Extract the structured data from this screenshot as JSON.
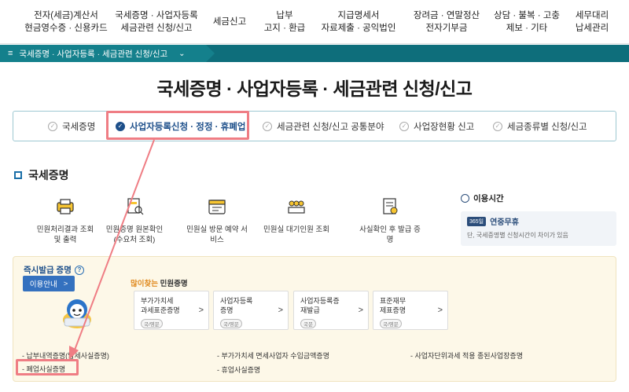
{
  "topnav": [
    {
      "line1": "전자(세금)계산서",
      "line2": "현금영수증 · 신용카드"
    },
    {
      "line1": "국세증명 · 사업자등록",
      "line2": "세금관련 신청/신고"
    },
    {
      "line1": "세금신고",
      "line2": ""
    },
    {
      "line1": "납부",
      "line2": "고지 · 환급"
    },
    {
      "line1": "지급명세서",
      "line2": "자료제출 · 공익법인"
    },
    {
      "line1": "장려금 · 연말정산",
      "line2": "전자기부금"
    },
    {
      "line1": "상담 · 불복 · 고충",
      "line2": "제보 · 기타"
    },
    {
      "line1": "세무대리",
      "line2": "납세관리"
    }
  ],
  "breadcrumb": {
    "menu_icon": "≡",
    "label": "국세증명 · 사업자등록 · 세금관련 신청/신고",
    "chevron": "⌄"
  },
  "page_title": "국세증명 · 사업자등록 · 세금관련 신청/신고",
  "tabs": [
    {
      "label": "국세증명",
      "active": false
    },
    {
      "label": "사업자등록신청 · 정정 · 휴폐업",
      "active": true
    },
    {
      "label": "세금관련 신청/신고 공통분야",
      "active": false
    },
    {
      "label": "사업장현황 신고",
      "active": false
    },
    {
      "label": "세금종류별 신청/신고",
      "active": false
    }
  ],
  "section_title": "국세증명",
  "services": [
    {
      "line1": "민원처리결과 조회",
      "line2": "및 출력",
      "icon": "printer-icon"
    },
    {
      "line1": "민원증명 원본확인",
      "line2": "(수요처 조회)",
      "icon": "document-search-icon"
    },
    {
      "line1": "민원실 방문 예약 서비스",
      "line2": "",
      "icon": "calendar-icon"
    },
    {
      "line1": "민원실 대기인원 조회",
      "line2": "",
      "icon": "queue-icon"
    },
    {
      "line1": "사실확인 후 발급 증명",
      "line2": "",
      "icon": "certificate-icon"
    }
  ],
  "hours": {
    "title": "이용시간",
    "badge": "365일",
    "headline": "연중무휴",
    "note": "단, 국세증명별 신청시간이 차이가 있음"
  },
  "instant": {
    "title": "즉시발급 증명",
    "help": "?",
    "guide_button": "이용안내",
    "guide_arrow": ">",
    "popular_accent": "많이찾는",
    "popular_rest": " 민원증명"
  },
  "certs": [
    {
      "line1": "부가가치세",
      "line2": "과세표준증명",
      "tag": "국/영문"
    },
    {
      "line1": "사업자등록",
      "line2": "증명",
      "tag": "국/영문"
    },
    {
      "line1": "사업자등록증",
      "line2": "재발급",
      "tag": "국문"
    },
    {
      "line1": "표준재무",
      "line2": "제표증명",
      "tag": "국/영문"
    }
  ],
  "cert_arrow": ">",
  "links": [
    "- 납부내역증명(납세사실증명)",
    "- 부가가치세 면세사업자 수입금액증명",
    "- 사업자단위과세 적용 종된사업장증명",
    "- 폐업사실증명",
    "- 휴업사실증명"
  ],
  "colors": {
    "crumb_bar": "#0e6e7b",
    "highlight": "#ef7d84",
    "accent_blue": "#1d4f8a",
    "panel_bg": "#fdf8e8",
    "popular_orange": "#e08a1e"
  }
}
